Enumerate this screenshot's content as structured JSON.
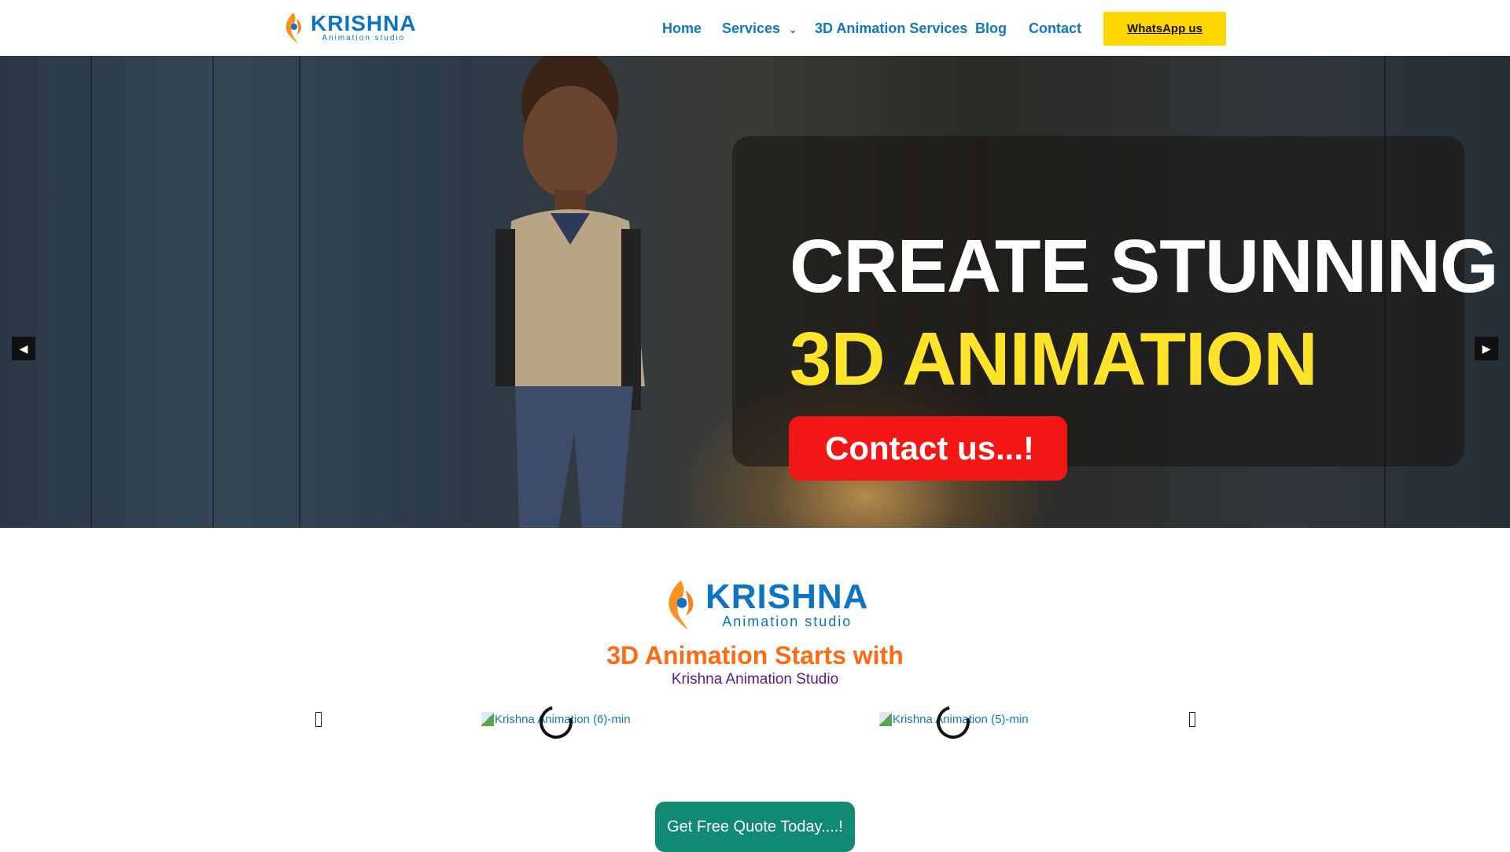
{
  "header": {
    "logo": {
      "name": "KRISHNA",
      "tagline": "Animation studio"
    },
    "nav": [
      {
        "label": "Home"
      },
      {
        "label": "Services"
      },
      {
        "label": "3D Animation Services"
      },
      {
        "label": "Blog"
      },
      {
        "label": "Contact"
      }
    ],
    "whatsapp_label": "WhatsApp us"
  },
  "hero": {
    "line1": "CREATE STUNNING",
    "line2": "3D ANIMATION",
    "cta": "Contact us...!",
    "prev_icon": "caret-left-icon",
    "next_icon": "caret-right-icon"
  },
  "intro": {
    "logo": {
      "name": "KRISHNA",
      "tagline": "Animation studio"
    },
    "headline": "3D Animation Starts with",
    "subheadline": "Krishna Animation Studio"
  },
  "carousel": {
    "images": [
      {
        "alt": "Krishna Animation (6)-min"
      },
      {
        "alt": "Krishna Animation (5)-min"
      }
    ]
  },
  "quote_button": "Get Free Quote Today....!",
  "colors": {
    "brand_blue": "#1178c0",
    "orange": "#ff6a13",
    "purple": "#5a1a8a",
    "yellow": "#fed600",
    "red": "#f41515",
    "teal": "#108a72"
  }
}
